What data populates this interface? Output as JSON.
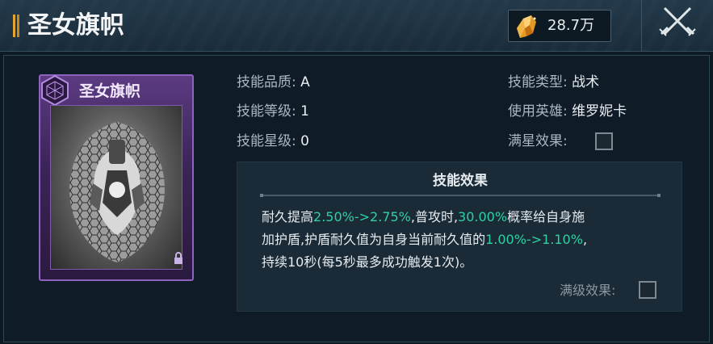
{
  "header": {
    "title": "圣女旗帜",
    "currency_value": "28.7万",
    "currency_icon": "amber-crystal-icon",
    "close_icon": "crossed-swords-close-icon"
  },
  "card": {
    "title": "圣女旗帜",
    "badge_icon": "hexagon-rune-icon",
    "frame_color": "#8e63bf",
    "lock_icon": "lock-icon"
  },
  "attributes": {
    "quality_label": "技能品质:",
    "quality_value": "A",
    "level_label": "技能等级:",
    "level_value": "1",
    "star_label": "技能星级:",
    "star_value": "0",
    "type_label": "技能类型:",
    "type_value": "战术",
    "hero_label": "使用英雄:",
    "hero_value": "维罗妮卡",
    "maxstar_label": "满星效果:"
  },
  "effect": {
    "title": "技能效果",
    "line1_a": "耐久提高",
    "line1_hl1": "2.50%->2.75%",
    "line1_b": ",普攻时,",
    "line1_hl2": "30.00%",
    "line1_c": "概率给自身施",
    "line2_a": "加护盾,护盾耐久值为自身当前耐久值的",
    "line2_hl": "1.00%->1.10%",
    "line2_b": ",",
    "line3": "持续10秒(每5秒最多成功触发1次)。",
    "maxlevel_label": "满级效果:",
    "highlight_color": "#2fd0a8"
  }
}
